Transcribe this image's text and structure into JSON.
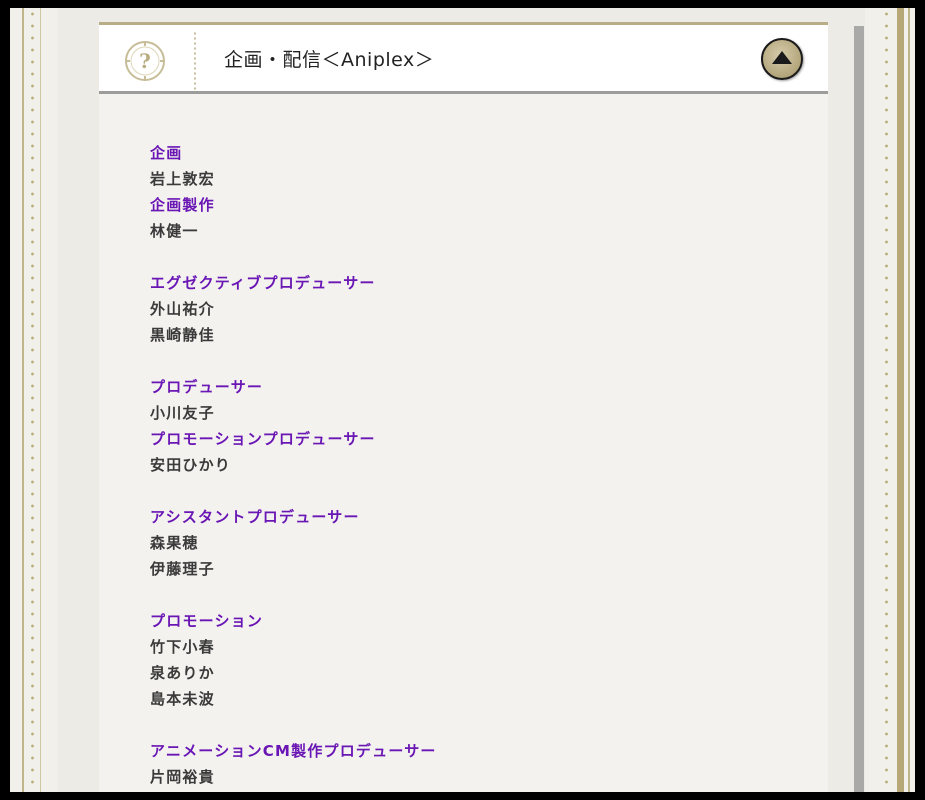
{
  "header": {
    "title": "企画・配信＜Aniplex＞",
    "help_icon_glyph": "?",
    "top_button_icon": "up-triangle-icon"
  },
  "credits": [
    [
      {
        "kind": "role",
        "text": "企画"
      },
      {
        "kind": "name",
        "text": "岩上敦宏"
      },
      {
        "kind": "role",
        "text": "企画製作"
      },
      {
        "kind": "name",
        "text": "林健一"
      }
    ],
    [
      {
        "kind": "role",
        "text": "エグゼクティブプロデューサー"
      },
      {
        "kind": "name",
        "text": "外山祐介"
      },
      {
        "kind": "name",
        "text": "黒崎静佳"
      }
    ],
    [
      {
        "kind": "role",
        "text": "プロデューサー"
      },
      {
        "kind": "name",
        "text": "小川友子"
      },
      {
        "kind": "role",
        "text": "プロモーションプロデューサー"
      },
      {
        "kind": "name",
        "text": "安田ひかり"
      }
    ],
    [
      {
        "kind": "role",
        "text": "アシスタントプロデューサー"
      },
      {
        "kind": "name",
        "text": "森果穂"
      },
      {
        "kind": "name",
        "text": "伊藤理子"
      }
    ],
    [
      {
        "kind": "role",
        "text": "プロモーション"
      },
      {
        "kind": "name",
        "text": "竹下小春"
      },
      {
        "kind": "name",
        "text": "泉ありか"
      },
      {
        "kind": "name",
        "text": "島本未波"
      }
    ],
    [
      {
        "kind": "role",
        "text": "アニメーションCM製作プロデューサー"
      },
      {
        "kind": "name",
        "text": "片岡裕貴"
      }
    ]
  ],
  "colors": {
    "role": "#6a16b4",
    "name": "#3a3a3a",
    "accent_gold": "#b8ad86"
  }
}
